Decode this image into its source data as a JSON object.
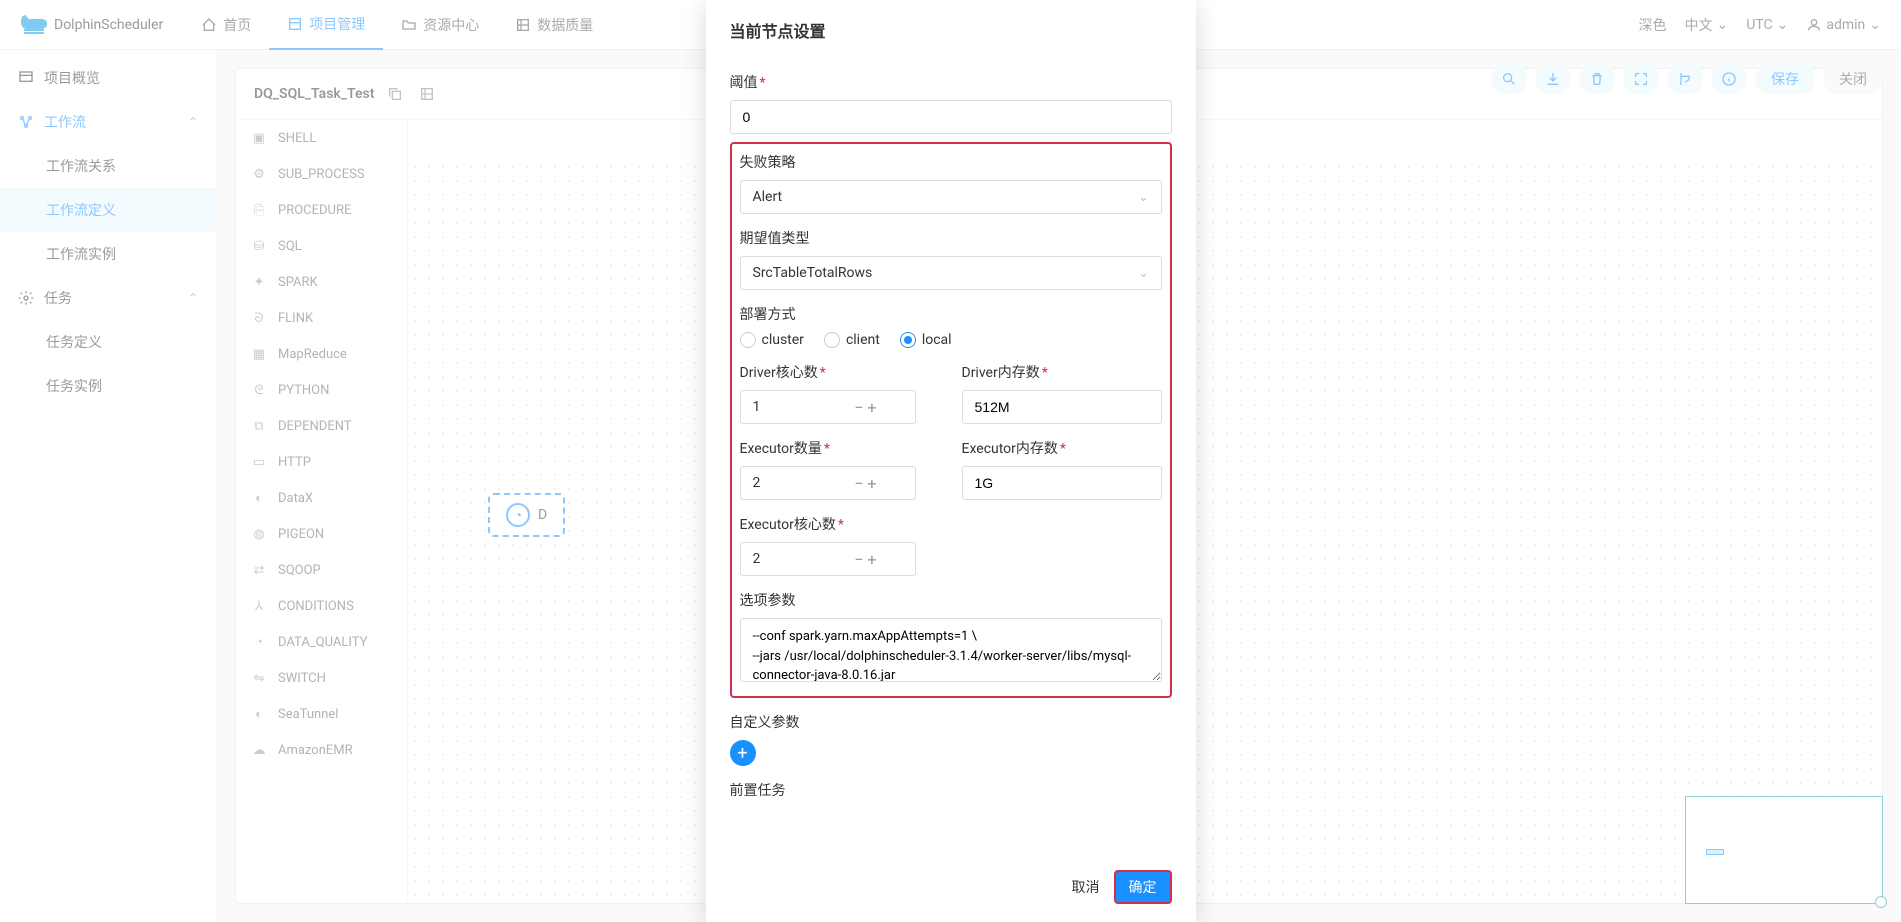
{
  "brand": "DolphinScheduler",
  "nav": {
    "home": "首页",
    "project": "项目管理",
    "resource": "资源中心",
    "dataquality": "数据质量"
  },
  "nav_right": {
    "theme": "深色",
    "lang": "中文",
    "tz": "UTC",
    "user": "admin"
  },
  "sidebar": {
    "overview": "项目概览",
    "workflow": "工作流",
    "workflow_relation": "工作流关系",
    "workflow_definition": "工作流定义",
    "workflow_instance": "工作流实例",
    "task": "任务",
    "task_definition": "任务定义",
    "task_instance": "任务实例"
  },
  "workflow": {
    "name": "DQ_SQL_Task_Test"
  },
  "toolbar": {
    "save": "保存",
    "close": "关闭"
  },
  "palette": [
    "SHELL",
    "SUB_PROCESS",
    "PROCEDURE",
    "SQL",
    "SPARK",
    "FLINK",
    "MapReduce",
    "PYTHON",
    "DEPENDENT",
    "HTTP",
    "DataX",
    "PIGEON",
    "SQOOP",
    "CONDITIONS",
    "DATA_QUALITY",
    "SWITCH",
    "SeaTunnel",
    "AmazonEMR"
  ],
  "task_node": {
    "label": "D"
  },
  "modal": {
    "title": "当前节点设置",
    "threshold_label": "阈值",
    "threshold_value": "0",
    "fail_strategy_label": "失败策略",
    "fail_strategy_value": "Alert",
    "expect_type_label": "期望值类型",
    "expect_type_value": "SrcTableTotalRows",
    "deploy_label": "部署方式",
    "deploy_cluster": "cluster",
    "deploy_client": "client",
    "deploy_local": "local",
    "driver_cores_label": "Driver核心数",
    "driver_cores_value": "1",
    "driver_mem_label": "Driver内存数",
    "driver_mem_value": "512M",
    "executor_num_label": "Executor数量",
    "executor_num_value": "2",
    "executor_mem_label": "Executor内存数",
    "executor_mem_value": "1G",
    "executor_cores_label": "Executor核心数",
    "executor_cores_value": "2",
    "opts_label": "选项参数",
    "opts_value": "--conf spark.yarn.maxAppAttempts=1 \\\n--jars /usr/local/dolphinscheduler-3.1.4/worker-server/libs/mysql-connector-java-8.0.16.jar",
    "custom_params_label": "自定义参数",
    "pre_tasks_label": "前置任务",
    "cancel": "取消",
    "confirm": "确定"
  }
}
